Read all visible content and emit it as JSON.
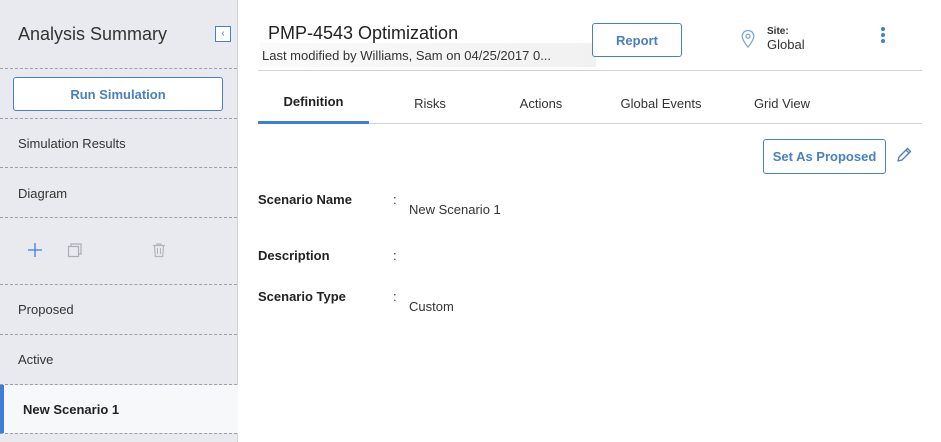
{
  "sidebar": {
    "title": "Analysis Summary",
    "run_simulation_label": "Run Simulation",
    "items": [
      {
        "label": "Simulation Results"
      },
      {
        "label": "Diagram"
      }
    ],
    "scenario_groups": [
      {
        "label": "Proposed"
      },
      {
        "label": "Active"
      }
    ],
    "selected_scenario": "New Scenario 1",
    "icons": [
      "collapse-icon",
      "add-icon",
      "copy-icon",
      "delete-icon"
    ]
  },
  "header": {
    "title": "PMP-4543 Optimization",
    "modified": "Last modified by Williams, Sam on 04/25/2017 0...",
    "report_label": "Report",
    "site_label": "Site:",
    "site_value": "Global"
  },
  "tabs": [
    {
      "label": "Definition",
      "active": true
    },
    {
      "label": "Risks",
      "active": false
    },
    {
      "label": "Actions",
      "active": false
    },
    {
      "label": "Global Events",
      "active": false
    },
    {
      "label": "Grid View",
      "active": false
    }
  ],
  "definition": {
    "set_proposed_label": "Set As Proposed",
    "fields": [
      {
        "label": "Scenario Name",
        "value": "New Scenario 1"
      },
      {
        "label": "Description",
        "value": ""
      },
      {
        "label": "Scenario Type",
        "value": "Custom"
      }
    ]
  },
  "colors": {
    "accent": "#3f7ed8",
    "sidebar_bg": "#e8eaf0",
    "border": "#cfd3da"
  }
}
